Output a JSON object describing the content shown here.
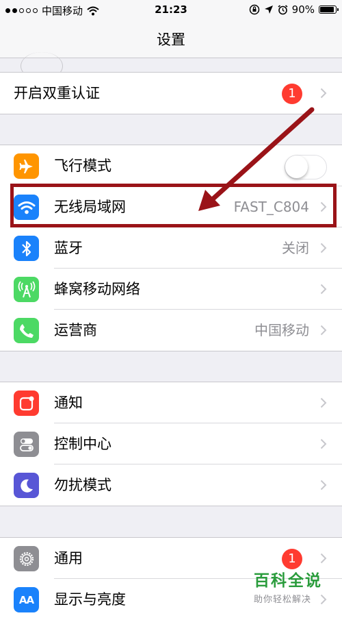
{
  "status": {
    "carrier": "中国移动",
    "time": "21:23",
    "battery": "90%",
    "battery_level": 0.9
  },
  "nav": {
    "title": "设置"
  },
  "two_factor": {
    "label": "开启双重认证",
    "badge": "1"
  },
  "network": [
    {
      "label": "飞行模式",
      "icon": "airplane-icon",
      "color": "#ff9500",
      "toggle_on": false
    },
    {
      "label": "无线局域网",
      "icon": "wifi-icon",
      "color": "#1a82fb",
      "value": "FAST_C804"
    },
    {
      "label": "蓝牙",
      "icon": "bluetooth-icon",
      "color": "#1a82fb",
      "value": "关闭"
    },
    {
      "label": "蜂窝移动网络",
      "icon": "cellular-icon",
      "color": "#4cd964"
    },
    {
      "label": "运营商",
      "icon": "phone-icon",
      "color": "#4cd964",
      "value": "中国移动"
    }
  ],
  "system": [
    {
      "label": "通知",
      "icon": "notifications-icon",
      "color": "#ff3b30"
    },
    {
      "label": "控制中心",
      "icon": "control-center-icon",
      "color": "#8e8e93"
    },
    {
      "label": "勿扰模式",
      "icon": "moon-icon",
      "color": "#5856d6"
    }
  ],
  "general": [
    {
      "label": "通用",
      "icon": "gear-icon",
      "color": "#8e8e93",
      "badge": "1"
    },
    {
      "label": "显示与亮度",
      "icon": "display-icon",
      "color": "#1a82fb",
      "icon_text": "AA"
    }
  ],
  "watermark": {
    "title": "百科全说",
    "subtitle": "助你轻松解决"
  }
}
